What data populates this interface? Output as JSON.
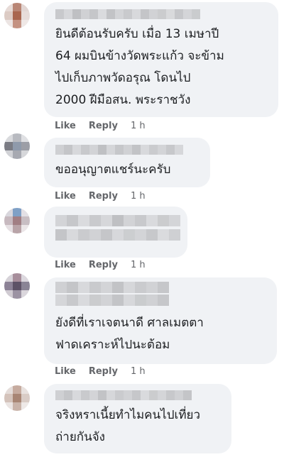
{
  "comments": [
    {
      "text": "ยินดีต้อนรับครับ เมื่อ 13 เมษาปี\n64 ผมบินข้างวัดพระแก้ว จะข้าม\nไปเก็บภาพวัดอรุณ โดนไป\n2000 ฝีมือสน. พระราชวัง",
      "like": "Like",
      "reply": "Reply",
      "time": "1 h"
    },
    {
      "text": "ขออนุญาตแชร์นะครับ",
      "like": "Like",
      "reply": "Reply",
      "time": "1 h"
    },
    {
      "text": "",
      "like": "Like",
      "reply": "Reply",
      "time": "1 h"
    },
    {
      "text": "ยังดีที่เราเจตนาดี ศาลเมตตา\nฟาดเคราะห์ไปนะต้อม",
      "like": "Like",
      "reply": "Reply",
      "time": "1 h"
    },
    {
      "text": "จริงหราเนี้ยทำไมคนไปเที่ยว\nถ่ายกันจัง"
    }
  ],
  "colors": {
    "bubble": "#f0f2f5",
    "action_text": "#65676b",
    "body_text": "#1c1e21"
  }
}
